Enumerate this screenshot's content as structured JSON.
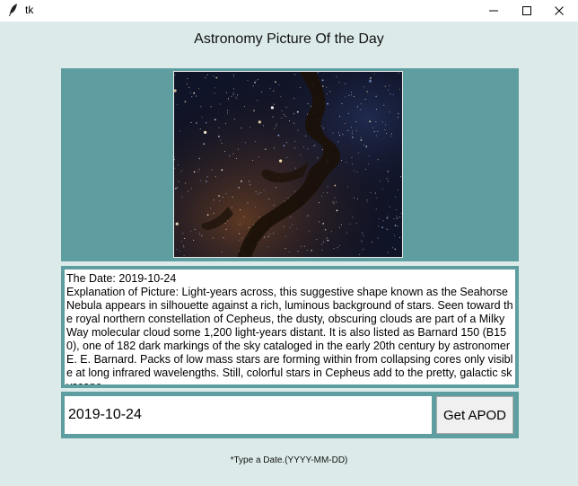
{
  "window": {
    "title": "tk",
    "icon": "feather-icon",
    "controls": [
      "minimize-icon",
      "maximize-icon",
      "close-icon"
    ]
  },
  "app": {
    "title": "Astronomy Picture Of the Day"
  },
  "apod": {
    "date_line": "The Date: 2019-10-24",
    "explanation": "Explanation of Picture: Light-years across, this suggestive shape known as the Seahorse Nebula appears in silhouette against a rich, luminous background of stars. Seen toward the royal northern constellation of Cepheus, the dusty, obscuring clouds are part of a Milky Way molecular cloud some 1,200 light-years distant. It is also listed as Barnard 150 (B150), one of 182 dark markings of the sky cataloged in the early 20th century by astronomer E. E. Barnard. Packs of low mass stars are forming within from collapsing cores only visible at long infrared wavelengths. Still, colorful stars in Cepheus add to the pretty, galactic skyscape."
  },
  "form": {
    "date_value": "2019-10-24",
    "button_label": "Get APOD",
    "hint": "*Type a Date.(YYYY-MM-DD)"
  },
  "colors": {
    "background": "#dcebea",
    "panel": "#5f9ea0"
  }
}
